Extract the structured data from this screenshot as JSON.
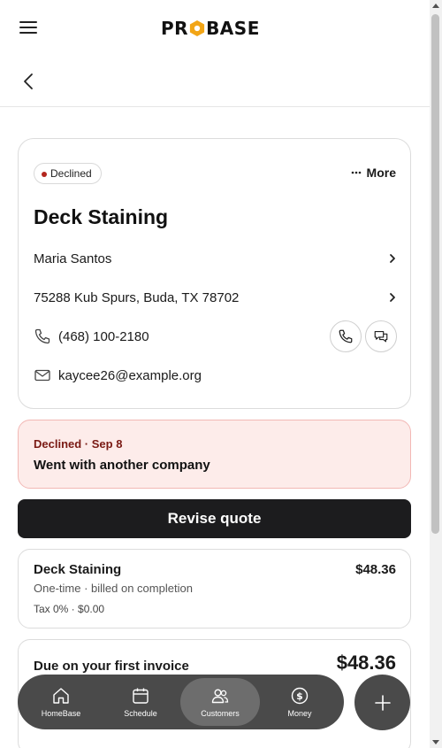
{
  "header": {
    "logo_left": "PR",
    "logo_right": "BASE"
  },
  "job": {
    "status_badge": "Declined",
    "more_label": "More",
    "title": "Deck Staining",
    "customer_name": "Maria Santos",
    "address": "75288 Kub Spurs, Buda, TX 78702",
    "phone": "(468) 100-2180",
    "email": "kaycee26@example.org"
  },
  "declined": {
    "status_line": "Declined · Sep 8",
    "reason": "Went with another company"
  },
  "actions": {
    "revise_label": "Revise quote"
  },
  "line_item": {
    "name": "Deck Staining",
    "price": "$48.36",
    "billing": "One-time · billed on completion",
    "tax": "Tax 0% · $0.00"
  },
  "due": {
    "label": "Due on your first invoice",
    "amount": "$48.36"
  },
  "nav": {
    "items": [
      {
        "label": "HomeBase",
        "icon": "home-icon"
      },
      {
        "label": "Schedule",
        "icon": "calendar-icon"
      },
      {
        "label": "Customers",
        "icon": "users-icon"
      },
      {
        "label": "Money",
        "icon": "dollar-icon"
      }
    ],
    "active": "Customers",
    "fab_icon": "plus-icon"
  },
  "colors": {
    "declined_dot": "#b3261e",
    "declined_bg": "#fdecea",
    "primary_button": "#1c1c1e",
    "nav_bg": "#4a4a4a",
    "logo_accent": "#f2a516"
  }
}
